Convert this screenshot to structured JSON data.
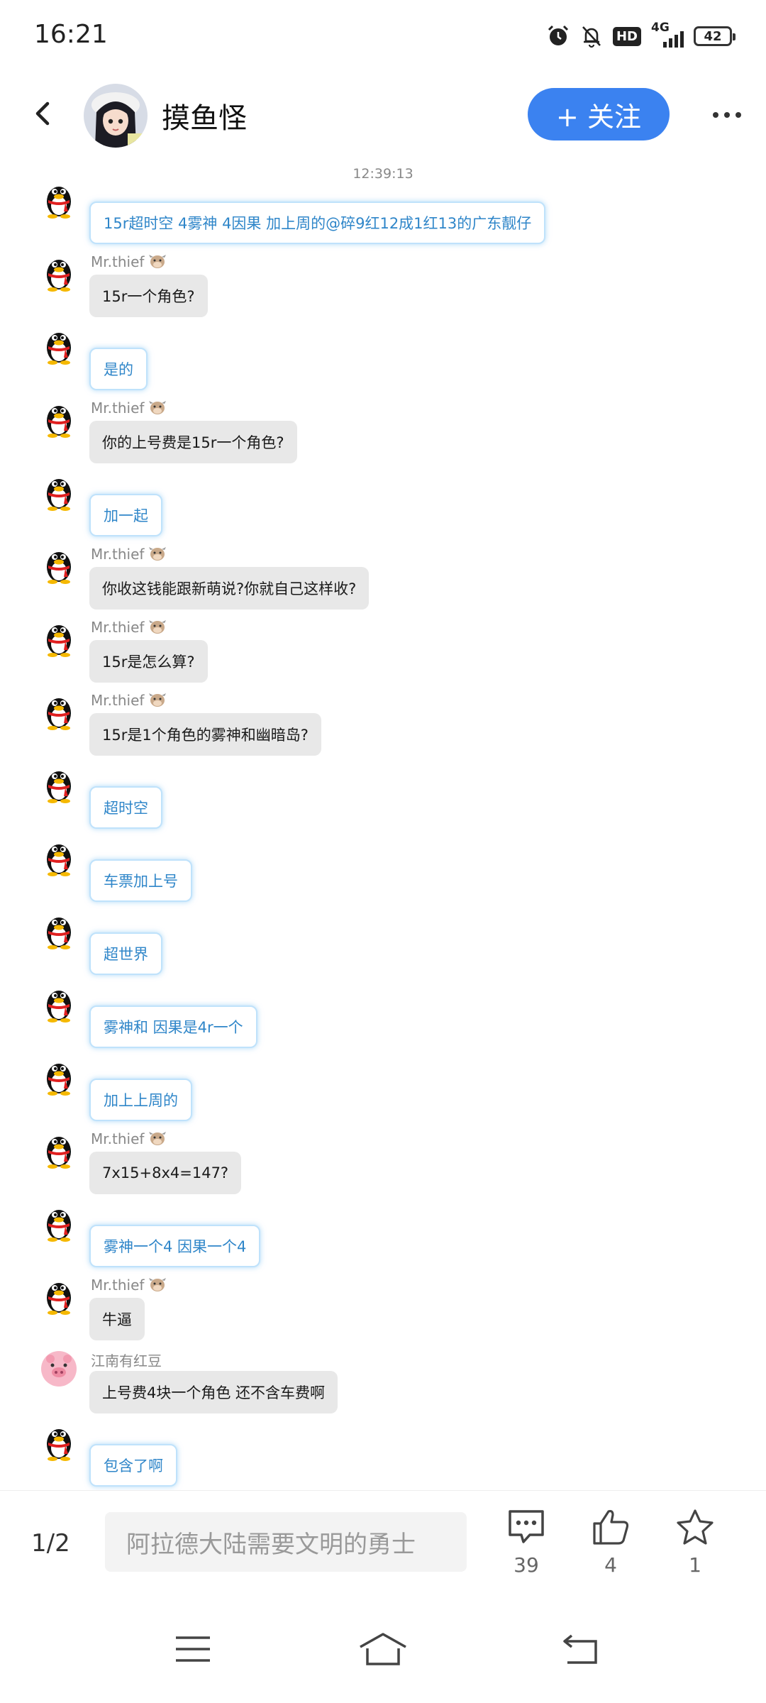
{
  "status_bar": {
    "time": "16:21",
    "hd": "HD",
    "network": "4G",
    "battery": "42"
  },
  "header": {
    "title": "摸鱼怪",
    "follow_label": "+ 关注"
  },
  "chat": {
    "timestamp": "12:39:13",
    "messages": [
      {
        "sender": "",
        "side": "me",
        "text": "15r超时空 4雾神 4因果 加上周的@碎9红12成1红13的广东靓仔"
      },
      {
        "sender": "Mr.thief",
        "side": "other",
        "text": "15r一个角色?"
      },
      {
        "sender": "",
        "side": "me",
        "text": "是的"
      },
      {
        "sender": "Mr.thief",
        "side": "other",
        "text": "你的上号费是15r一个角色?"
      },
      {
        "sender": "",
        "side": "me",
        "text": "加一起"
      },
      {
        "sender": "Mr.thief",
        "side": "other",
        "text": "你收这钱能跟新萌说?你就自己这样收?"
      },
      {
        "sender": "Mr.thief",
        "side": "other",
        "text": "15r是怎么算?"
      },
      {
        "sender": "Mr.thief",
        "side": "other",
        "text": "15r是1个角色的雾神和幽暗岛?"
      },
      {
        "sender": "",
        "side": "me",
        "text": "超时空"
      },
      {
        "sender": "",
        "side": "me",
        "text": "车票加上号"
      },
      {
        "sender": "",
        "side": "me",
        "text": "超世界"
      },
      {
        "sender": "",
        "side": "me",
        "text": "雾神和 因果是4r一个"
      },
      {
        "sender": "",
        "side": "me",
        "text": "加上上周的"
      },
      {
        "sender": "Mr.thief",
        "side": "other",
        "text": "7x15+8x4=147?"
      },
      {
        "sender": "",
        "side": "me",
        "text": "雾神一个4 因果一个4"
      },
      {
        "sender": "Mr.thief",
        "side": "other",
        "text": "牛逼"
      },
      {
        "sender": "江南有红豆",
        "side": "other",
        "text": "上号费4块一个角色 还不含车费啊"
      },
      {
        "sender": "",
        "side": "me",
        "text": "包含了啊"
      }
    ]
  },
  "bottom_bar": {
    "page_indicator": "1/2",
    "reply_placeholder": "阿拉德大陆需要文明的勇士",
    "comment_count": "39",
    "like_count": "4",
    "favorite_count": "1"
  },
  "colors": {
    "accent": "#3b82f0",
    "me_bubble_text": "#2f86c9",
    "me_bubble_border": "#bfe2fb",
    "other_bubble_bg": "#e8e8e8"
  },
  "icons": {
    "back": "back-arrow-icon",
    "more": "more-dots-icon",
    "comment": "comment-icon",
    "like": "thumbs-up-icon",
    "favorite": "star-icon",
    "menu": "menu-icon",
    "home": "home-icon",
    "return": "return-icon",
    "penguin": "penguin-avatar-icon",
    "cow": "cow-badge-icon"
  }
}
